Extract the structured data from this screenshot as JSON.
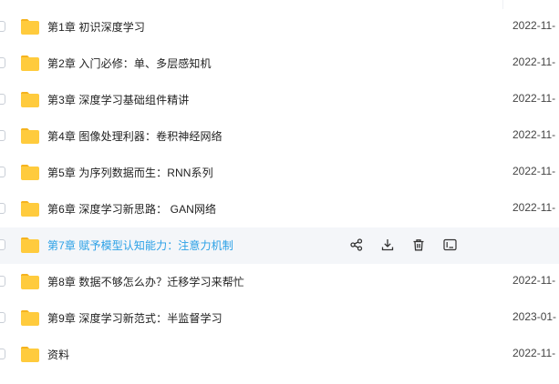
{
  "files": [
    {
      "name": "第1章 初识深度学习",
      "date": "2022-11-"
    },
    {
      "name": "第2章 入门必修：单、多层感知机",
      "date": "2022-11-"
    },
    {
      "name": "第3章 深度学习基础组件精讲",
      "date": "2022-11-"
    },
    {
      "name": "第4章 图像处理利器：卷积神经网络",
      "date": "2022-11-"
    },
    {
      "name": "第5章 为序列数据而生：RNN系列",
      "date": "2022-11-"
    },
    {
      "name": "第6章 深度学习新思路： GAN网络",
      "date": "2022-11-"
    },
    {
      "name": "第7章 赋予模型认知能力：注意力机制",
      "date": ""
    },
    {
      "name": "第8章 数据不够怎么办？迁移学习来帮忙",
      "date": "2022-11-"
    },
    {
      "name": "第9章 深度学习新范式：半监督学习",
      "date": "2023-01-"
    },
    {
      "name": "资料",
      "date": "2022-11-"
    }
  ],
  "hovered_row_index": 6,
  "hover_actions": [
    "share-icon",
    "download-icon",
    "delete-icon",
    "rename-icon"
  ],
  "colors": {
    "folder": "#ffcb3d",
    "folder_tab": "#f5b31f",
    "hover_text": "#2aa0e6",
    "hover_bg": "#f4f6f9"
  }
}
